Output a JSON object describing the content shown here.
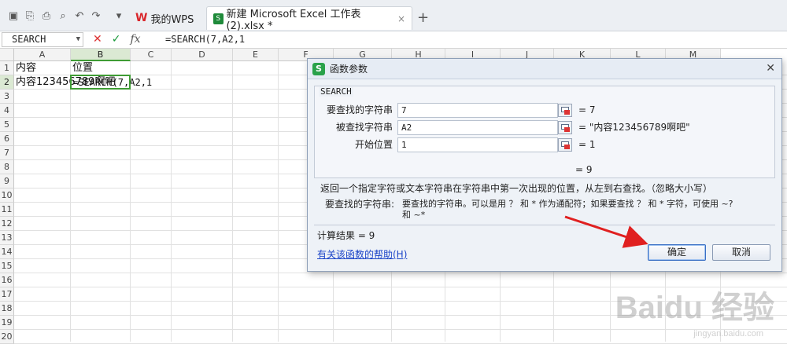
{
  "titlebar": {
    "wps_tab": "我的WPS",
    "file_tab": "新建 Microsoft Excel 工作表 (2).xlsx *",
    "close_glyph": "×",
    "new_tab_glyph": "+"
  },
  "formula_bar": {
    "name_box": "SEARCH",
    "cancel_glyph": "✕",
    "enter_glyph": "✓",
    "fx_label": "fx",
    "formula": "=SEARCH(7,A2,1"
  },
  "sheet": {
    "columns": [
      "A",
      "B",
      "C",
      "D",
      "E",
      "F",
      "G",
      "H",
      "I",
      "J",
      "K",
      "L",
      "M"
    ],
    "rows": [
      "1",
      "2",
      "3",
      "4",
      "5",
      "6",
      "7",
      "8",
      "9",
      "10",
      "11",
      "12",
      "13",
      "14",
      "15",
      "16",
      "17",
      "18",
      "19",
      "20"
    ],
    "cells": {
      "A1": "内容",
      "B1": "位置",
      "A2": "内容123456789啊吧",
      "B2": "=SEARCH(7,A2,1"
    }
  },
  "dialog": {
    "logo": "S",
    "title": "函数参数",
    "close_glyph": "✕",
    "function_name": "SEARCH",
    "args": [
      {
        "label": "要查找的字符串",
        "value": "7",
        "result": "= 7"
      },
      {
        "label": "被查找字符串",
        "value": "A2",
        "result": "= \"内容123456789啊吧\""
      },
      {
        "label": "开始位置",
        "value": "1",
        "result": "= 1"
      }
    ],
    "overall_result": "= 9",
    "description": "返回一个指定字符或文本字符串在字符串中第一次出现的位置，从左到右查找。（忽略大小写）",
    "arg_help_label": "要查找的字符串:",
    "arg_help_text_line1": "要查找的字符串。可以是用 ？ 和 * 作为通配符；如果要查找 ？ 和 * 字符，可使用 ~?",
    "arg_help_text_line2": "和 ~*",
    "calc_result": "计算结果 = 9",
    "help_link": "有关该函数的帮助(H)",
    "ok_label": "确定",
    "cancel_label": "取消"
  },
  "watermark": {
    "main": "Baidu 经验",
    "sub": "jingyan.baidu.com"
  },
  "colors": {
    "accent_green": "#3f9c35",
    "arrow_red": "#e02020",
    "link_blue": "#1b44c8"
  }
}
